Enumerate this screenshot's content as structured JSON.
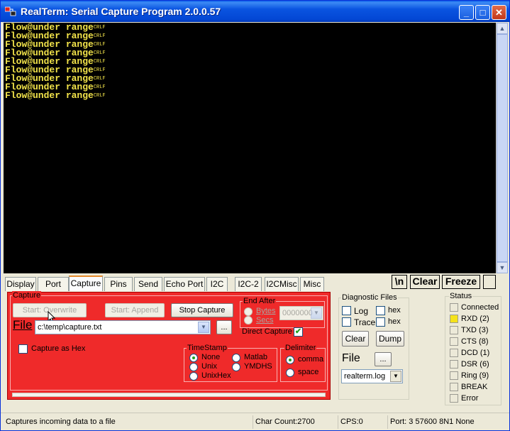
{
  "window": {
    "title": "RealTerm: Serial Capture Program 2.0.0.57",
    "minimize_glyph": "_",
    "maximize_glyph": "□",
    "close_glyph": "✕"
  },
  "terminal": {
    "lines": [
      "Flow@under range",
      "Flow@under range",
      "Flow@under range",
      "Flow@under range",
      "Flow@under range",
      "Flow@under range",
      "Flow@under range",
      "Flow@under range",
      "Flow@under range"
    ],
    "line_end": "CRLF"
  },
  "tabs": [
    "Display",
    "Port",
    "Capture",
    "Pins",
    "Send",
    "Echo Port",
    "I2C",
    "I2C-2",
    "I2CMisc",
    "Misc"
  ],
  "active_tab": "Capture",
  "toolbar": {
    "newline": "\\n",
    "clear": "Clear",
    "freeze": "Freeze"
  },
  "capture": {
    "group_label": "Capture",
    "start_overwrite": "Start: Overwrite",
    "start_append": "Start: Append",
    "stop_capture": "Stop Capture",
    "file_label": "File",
    "file_path": "c:\\temp\\capture.txt",
    "browse": "...",
    "capture_as_hex": "Capture as Hex",
    "end_after": {
      "label": "End After",
      "bytes": "Bytes",
      "secs": "Secs",
      "value": "0000000"
    },
    "direct_capture": "Direct Capture",
    "timestamp": {
      "label": "TimeStamp",
      "options": [
        "None",
        "Unix",
        "UnixHex",
        "Matlab",
        "YMDHS"
      ],
      "selected": "None"
    },
    "delimiter": {
      "label": "Delimiter",
      "options": [
        "comma",
        "space"
      ],
      "selected": "comma"
    }
  },
  "diagnostic": {
    "label": "Diagnostic Files",
    "log": "Log",
    "trace": "Trace",
    "hex1": "hex",
    "hex2": "hex",
    "clear": "Clear",
    "dump": "Dump",
    "file_label": "File",
    "browse": "...",
    "file_select": "realterm.log"
  },
  "status": {
    "label": "Status",
    "items": [
      "Connected",
      "RXD (2)",
      "TXD (3)",
      "CTS (8)",
      "DCD (1)",
      "DSR (6)",
      "Ring (9)",
      "BREAK",
      "Error"
    ],
    "active": "RXD (2)",
    "led_on_color": "#f5e21a"
  },
  "statusbar": {
    "hint": "Captures incoming data to a file",
    "char_count": "Char Count:2700",
    "cps": "CPS:0",
    "port": "Port: 3 57600 8N1 None"
  },
  "colors": {
    "terminal_bg": "#000000",
    "terminal_text": "#f2e34a",
    "capture_panel": "#ef2a2a",
    "titlebar": "#0a54e0"
  }
}
